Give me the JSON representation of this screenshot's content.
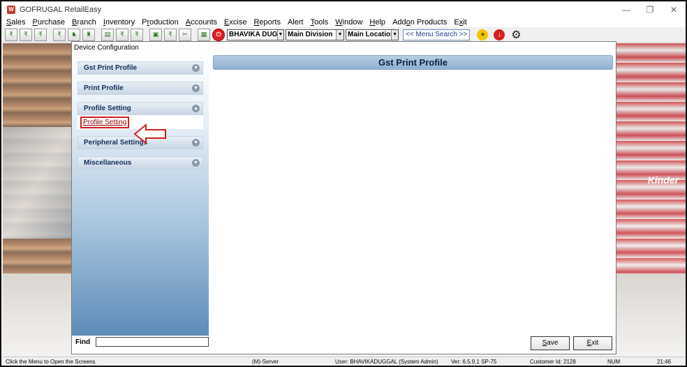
{
  "window": {
    "title": "GOFRUGAL RetailEasy",
    "logo_text": "W",
    "controls": [
      "—",
      "❐",
      "✕"
    ]
  },
  "menubar": [
    {
      "pre": "",
      "ul": "S",
      "post": "ales"
    },
    {
      "pre": "",
      "ul": "P",
      "post": "urchase"
    },
    {
      "pre": "",
      "ul": "B",
      "post": "ranch"
    },
    {
      "pre": "",
      "ul": "I",
      "post": "nventory"
    },
    {
      "pre": "P",
      "ul": "r",
      "post": "oduction"
    },
    {
      "pre": "",
      "ul": "A",
      "post": "ccounts"
    },
    {
      "pre": "",
      "ul": "E",
      "post": "xcise"
    },
    {
      "pre": "",
      "ul": "R",
      "post": "eports"
    },
    {
      "pre": "Alert",
      "ul": "",
      "post": ""
    },
    {
      "pre": "",
      "ul": "T",
      "post": "ools"
    },
    {
      "pre": "",
      "ul": "W",
      "post": "indow"
    },
    {
      "pre": "",
      "ul": "H",
      "post": "elp"
    },
    {
      "pre": "Add",
      "ul": "o",
      "post": "n Products"
    },
    {
      "pre": "E",
      "ul": "x",
      "post": "it"
    }
  ],
  "toolbar": {
    "user_combo": "BHAVIKA DUGG/",
    "division_combo": "Main Division",
    "location_combo": "Main Location",
    "menu_search": "<< Menu Search >>"
  },
  "child_window": {
    "title": "Device Configuration",
    "nav_groups": {
      "gst_print_profile": "Gst Print Profile",
      "print_profile": "Print Profile",
      "profile_setting": "Profile Setting",
      "profile_setting_link": "Profile Setting",
      "peripheral_settings": "Peripheral Settings",
      "miscellaneous": "Miscellaneous"
    },
    "find_label": "Find",
    "find_value": "",
    "content_header": "Gst Print Profile",
    "save_button": {
      "ul": "S",
      "post": "ave"
    },
    "exit_button": {
      "ul": "E",
      "post": "xit"
    }
  },
  "background": {
    "brand_text": "Kinder"
  },
  "statusbar": {
    "hint": "Click the Menu to Open the Screens",
    "server": "(M)-Server",
    "user": "User: BHAVIKADUGGAL (System Admin)",
    "version": "Ver: 6.5.9.1 SP-75",
    "customer": "Customer Id: 2128",
    "num": "NUM",
    "time": "21:46"
  }
}
